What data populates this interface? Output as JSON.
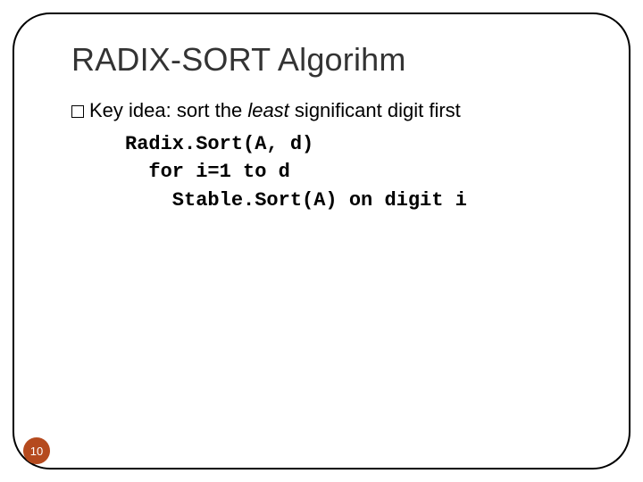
{
  "slide": {
    "title": "RADIX-SORT Algorihm",
    "key_idea_prefix": "Key idea: sort the ",
    "key_idea_emph": "least",
    "key_idea_suffix": " significant digit first",
    "code": {
      "l1": "Radix.Sort(A, d)",
      "l2": "  for i=1 to d",
      "l3": "    Stable.Sort(A) on digit i"
    },
    "page_number": "10"
  }
}
